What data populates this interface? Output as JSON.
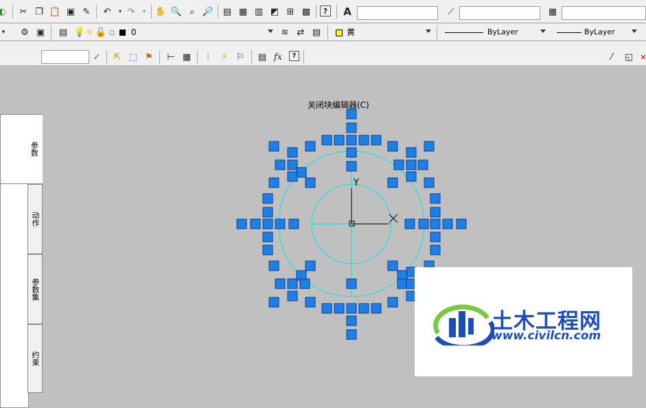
{
  "toolbar_standard": {
    "icons": [
      "open-icon",
      "cut-icon",
      "copy-icon",
      "paste-icon",
      "match-properties-icon",
      "brush-icon",
      "undo-icon",
      "redo-icon",
      "pan-icon",
      "zoom-realtime-icon",
      "zoom-window-icon",
      "zoom-previous-icon",
      "properties-icon",
      "design-center-icon",
      "tool-palettes-icon",
      "sheet-set-icon",
      "markup-icon",
      "calculator-icon",
      "help-icon"
    ],
    "text_style_value": "",
    "dim_style_value": "",
    "table_style_value": ""
  },
  "toolbar_layers": {
    "layer_value": "0",
    "color_value": "黄",
    "color_swatch": "#ffff00",
    "linetype_value": "ByLayer",
    "lineweight_value": "ByLayer"
  },
  "toolbar_block_editor": {
    "name_value": "",
    "close_label": "关闭块编辑器(C)",
    "fx_label": "fx"
  },
  "palette_tabs": [
    {
      "label": "参数"
    },
    {
      "label": "动作"
    },
    {
      "label": "参数集"
    },
    {
      "label": "约束"
    }
  ],
  "canvas": {
    "ucs_y_label": "Y",
    "grip_color": "#1e7fe8",
    "circle_color": "#00e5e5"
  },
  "watermark": {
    "title": "土木工程网",
    "url": "www.civilcn.com"
  }
}
